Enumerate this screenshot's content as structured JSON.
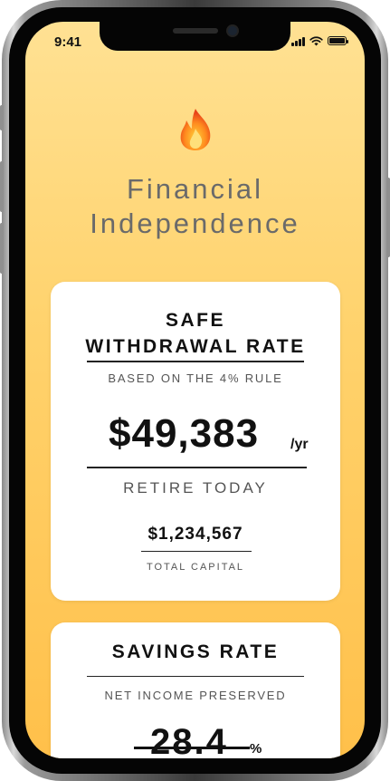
{
  "status_bar": {
    "time": "9:41"
  },
  "app": {
    "icon": "fire-icon",
    "title_line1": "Financial",
    "title_line2": "Independence"
  },
  "withdrawal_card": {
    "title_line1": "SAFE",
    "title_line2": "WITHDRAWAL RATE",
    "subtitle": "BASED ON THE 4% RULE",
    "amount": "$49,383",
    "amount_unit": "/yr",
    "retire_label": "RETIRE TODAY",
    "capital_value": "$1,234,567",
    "capital_label": "TOTAL CAPITAL"
  },
  "savings_card": {
    "title": "SAVINGS RATE",
    "subtitle": "NET INCOME PRESERVED",
    "value": "28.4",
    "unit": "%"
  },
  "colors": {
    "background_top": "#ffe193",
    "background_bottom": "#ffc04a",
    "card": "#ffffff",
    "text": "#111111"
  }
}
